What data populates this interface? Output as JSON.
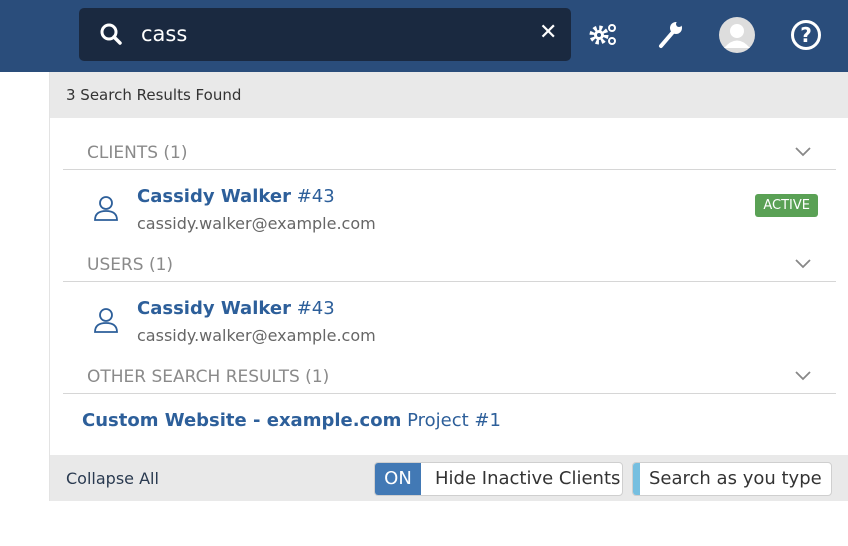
{
  "header": {
    "search_value": "cass",
    "icons": [
      "search-icon",
      "clear-icon",
      "gears-icon",
      "wrench-icon",
      "avatar",
      "help-icon"
    ]
  },
  "results": {
    "count_text": "3 Search Results Found",
    "sections": [
      {
        "title": "CLIENTS (1)",
        "items": [
          {
            "name": "Cassidy Walker",
            "id": "#43",
            "email": "cassidy.walker@example.com",
            "badge": "ACTIVE"
          }
        ]
      },
      {
        "title": "USERS (1)",
        "items": [
          {
            "name": "Cassidy Walker",
            "id": "#43",
            "email": "cassidy.walker@example.com"
          }
        ]
      },
      {
        "title": "OTHER SEARCH RESULTS (1)",
        "items": [
          {
            "name": "Custom Website - example.com",
            "suffix": "Project #1"
          }
        ]
      }
    ]
  },
  "footer": {
    "collapse_all": "Collapse All",
    "toggle_on": "ON",
    "hide_inactive": "Hide Inactive Clients",
    "search_as_you_type": "Search as you type"
  },
  "colors": {
    "header": "#2a4d7b",
    "search_bg": "#1a2940",
    "link": "#2d5f9a",
    "badge": "#5aa155",
    "toggle_on": "#4279b5"
  }
}
